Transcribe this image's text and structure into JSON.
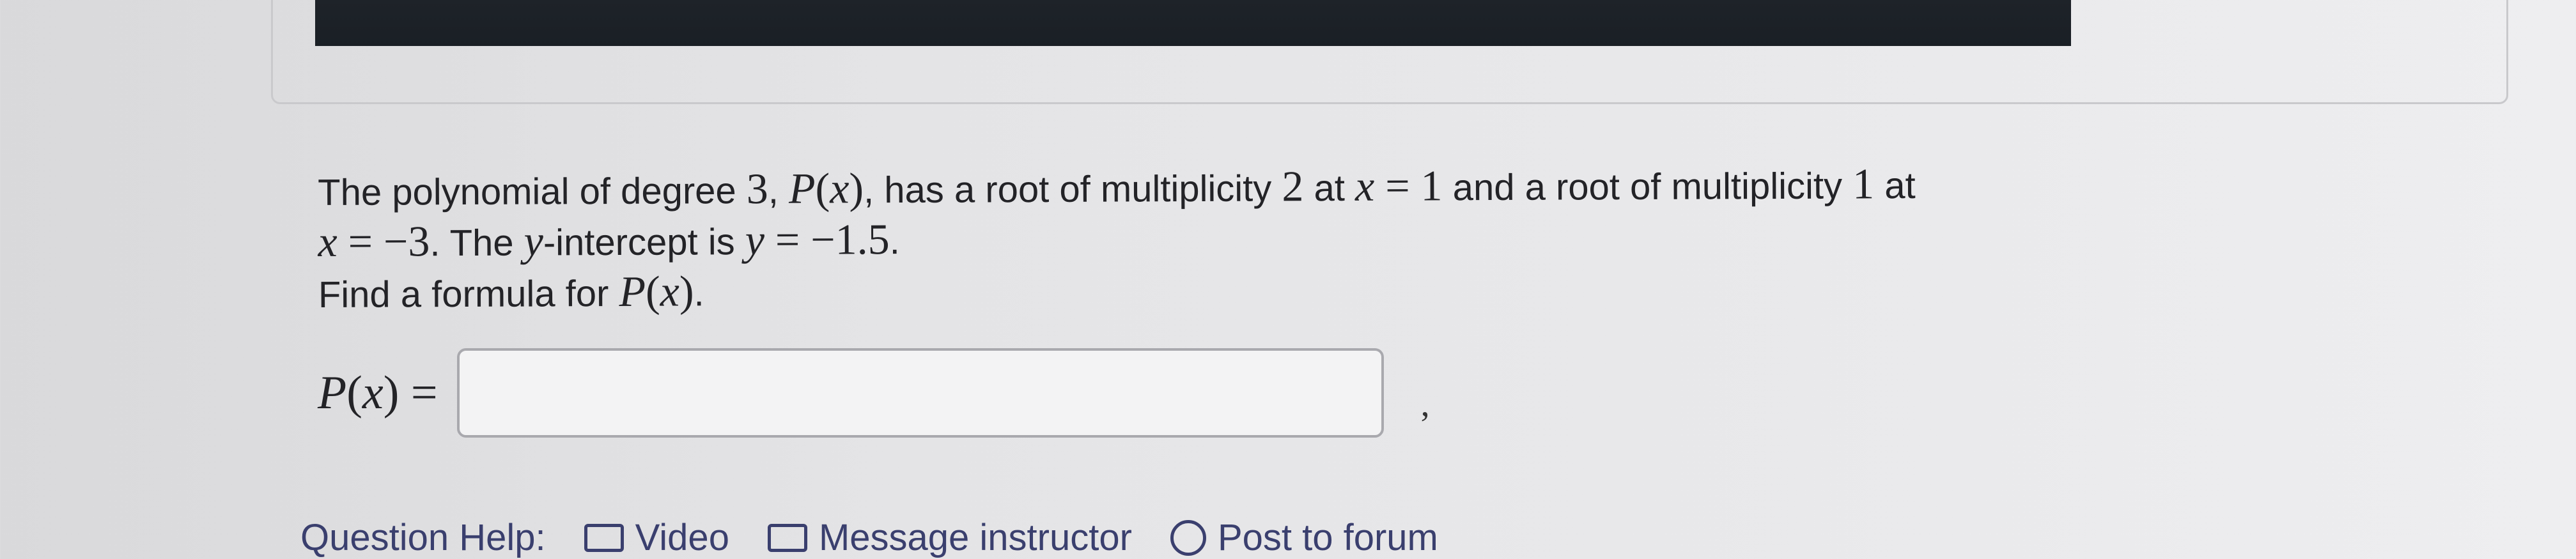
{
  "question": {
    "line1": {
      "t1": "The polynomial of degree ",
      "m_degree": "3",
      "t2": ", ",
      "m_P": "P",
      "m_paren_open": "(",
      "m_x": "x",
      "m_paren_close": ")",
      "t3": ", has a root of multiplicity ",
      "m_mult2": "2",
      "t4": " at ",
      "m_x2": "x",
      "m_eq1": " = 1",
      "t5": " and a root of multiplicity ",
      "m_mult1": "1",
      "t6": " at"
    },
    "line2": {
      "m_x": "x",
      "m_eq": " = −3",
      "t1": ". The ",
      "m_y": "y",
      "t2": "-intercept is ",
      "m_y2": "y",
      "m_eq2": " = −1.5",
      "t3": "."
    },
    "line3": {
      "t1": "Find a formula for ",
      "m_P": "P",
      "m_paren_open": "(",
      "m_x": "x",
      "m_paren_close": ")",
      "t2": "."
    }
  },
  "answer": {
    "label_P": "P",
    "label_open": "(",
    "label_x": "x",
    "label_close": ") =",
    "value": "",
    "trailing": ","
  },
  "bottom_links": [
    {
      "label": "Question Help:",
      "icon": "none"
    },
    {
      "label": "Video",
      "icon": "video-icon"
    },
    {
      "label": "Message instructor",
      "icon": "mail-icon"
    },
    {
      "label": "Post to forum",
      "icon": "forum-icon"
    }
  ]
}
